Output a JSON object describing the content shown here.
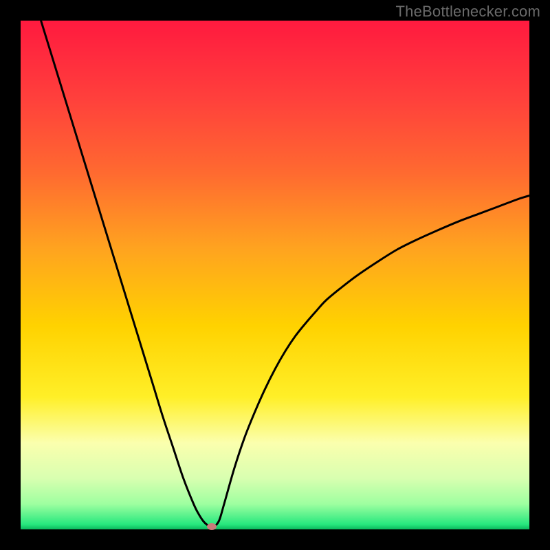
{
  "watermark": "TheBottlenecker.com",
  "chart_data": {
    "type": "line",
    "title": "",
    "xlabel": "",
    "ylabel": "",
    "xlim": [
      0,
      100
    ],
    "ylim": [
      0,
      100
    ],
    "x": [
      4,
      6,
      8,
      10,
      12,
      14,
      16,
      18,
      20,
      22,
      24,
      26,
      28,
      30,
      32,
      34,
      35,
      36,
      37,
      38,
      39,
      40,
      42,
      44,
      46,
      48,
      50,
      52,
      54,
      56,
      58,
      60,
      63,
      66,
      70,
      74,
      78,
      82,
      86,
      90,
      94,
      98,
      100
    ],
    "y": [
      100,
      93.5,
      87,
      80.5,
      74,
      67.5,
      61,
      54.5,
      48,
      41.5,
      35,
      28.5,
      22,
      16,
      10,
      5,
      3,
      1.5,
      0.7,
      0.6,
      1.7,
      5,
      12,
      18,
      23,
      27.5,
      31.5,
      35,
      38,
      40.5,
      42.8,
      45,
      47.5,
      49.8,
      52.5,
      55,
      57,
      58.8,
      60.5,
      62,
      63.5,
      65,
      65.6
    ],
    "marker": {
      "x": 37.6,
      "y": 0.6
    },
    "gradient_stops": [
      {
        "offset": 0.0,
        "color": "#ff1a3f"
      },
      {
        "offset": 0.15,
        "color": "#ff3f3c"
      },
      {
        "offset": 0.3,
        "color": "#ff6a30"
      },
      {
        "offset": 0.45,
        "color": "#ffa41f"
      },
      {
        "offset": 0.6,
        "color": "#ffd200"
      },
      {
        "offset": 0.74,
        "color": "#ffef28"
      },
      {
        "offset": 0.83,
        "color": "#fbffae"
      },
      {
        "offset": 0.9,
        "color": "#d8ffb0"
      },
      {
        "offset": 0.95,
        "color": "#9effa0"
      },
      {
        "offset": 0.99,
        "color": "#27e87e"
      },
      {
        "offset": 1.0,
        "color": "#0bb85d"
      }
    ]
  }
}
